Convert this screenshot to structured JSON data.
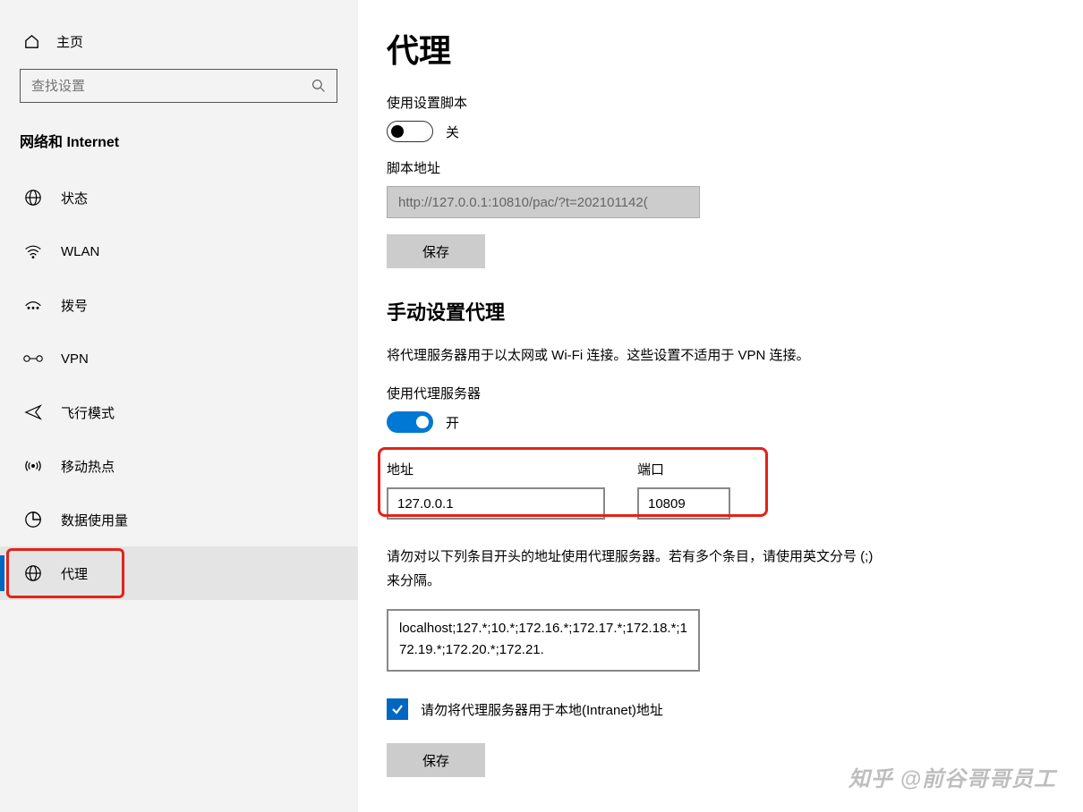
{
  "sidebar": {
    "home": "主页",
    "search_placeholder": "查找设置",
    "category": "网络和 Internet",
    "items": [
      {
        "label": "状态"
      },
      {
        "label": "WLAN"
      },
      {
        "label": "拨号"
      },
      {
        "label": "VPN"
      },
      {
        "label": "飞行模式"
      },
      {
        "label": "移动热点"
      },
      {
        "label": "数据使用量"
      },
      {
        "label": "代理"
      }
    ]
  },
  "main": {
    "title": "代理",
    "script": {
      "label": "使用设置脚本",
      "state_text": "关",
      "addr_label": "脚本地址",
      "addr_value": "http://127.0.0.1:10810/pac/?t=202101142(",
      "save": "保存"
    },
    "manual": {
      "heading": "手动设置代理",
      "desc": "将代理服务器用于以太网或 Wi-Fi 连接。这些设置不适用于 VPN 连接。",
      "use_label": "使用代理服务器",
      "state_text": "开",
      "addr_label": "地址",
      "addr_value": "127.0.0.1",
      "port_label": "端口",
      "port_value": "10809",
      "bypass_desc": "请勿对以下列条目开头的地址使用代理服务器。若有多个条目，请使用英文分号 (;) 来分隔。",
      "bypass_value": "localhost;127.*;10.*;172.16.*;172.17.*;172.18.*;172.19.*;172.20.*;172.21.",
      "intranet_label": "请勿将代理服务器用于本地(Intranet)地址",
      "save": "保存"
    }
  },
  "watermark": "知乎 @前谷哥哥员工"
}
